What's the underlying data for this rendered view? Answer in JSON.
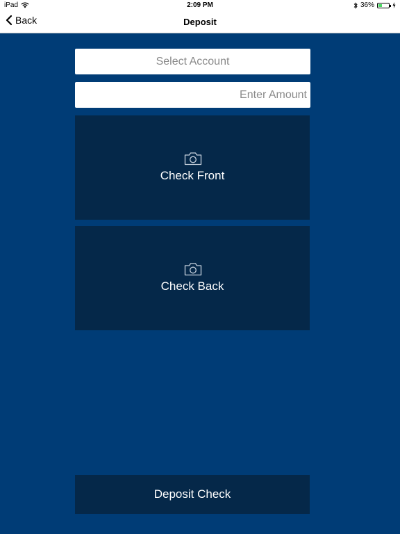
{
  "status_bar": {
    "device": "iPad",
    "time": "2:09 PM",
    "battery_percent": "36%",
    "battery_level": 0.36,
    "icons": [
      "wifi-icon",
      "bluetooth-icon",
      "battery-icon",
      "charging-icon"
    ]
  },
  "nav": {
    "back_label": "Back",
    "title": "Deposit"
  },
  "form": {
    "account_placeholder": "Select Account",
    "amount_placeholder": "Enter Amount"
  },
  "checks": {
    "front_label": "Check Front",
    "back_label": "Check Back",
    "icon": "camera-icon"
  },
  "actions": {
    "deposit_label": "Deposit Check"
  },
  "colors": {
    "background": "#003c76",
    "panel": "#052849",
    "field": "#ffffff",
    "placeholder": "#8a8a8a",
    "battery": "#4cd964"
  }
}
